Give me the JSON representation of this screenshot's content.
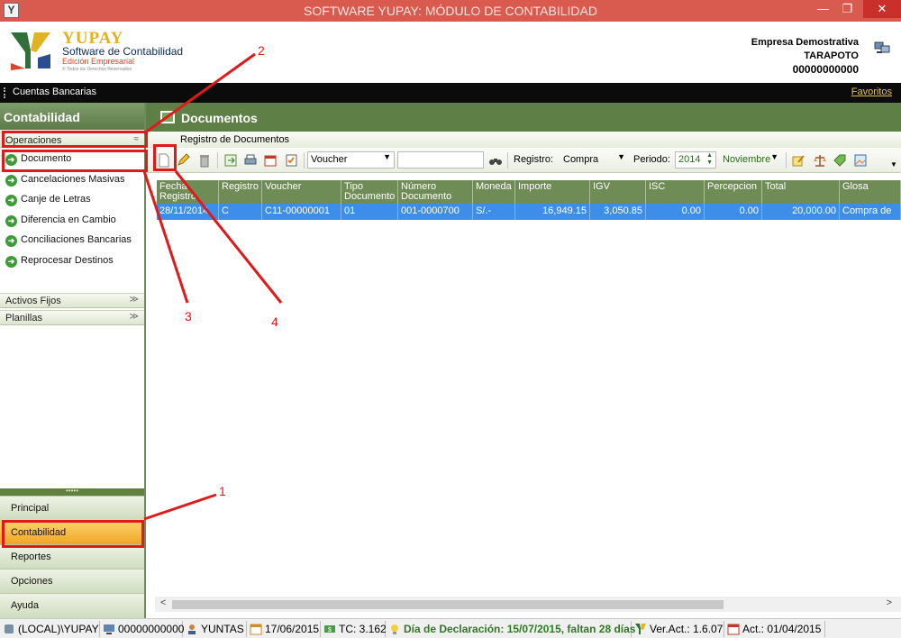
{
  "window": {
    "title": "SOFTWARE YUPAY: MÓDULO DE CONTABILIDAD",
    "app_icon": "Y",
    "minimize_icon": "—",
    "restore_icon": "❐",
    "close_icon": "✕"
  },
  "header": {
    "brand": "YUPAY",
    "tagline": "Software de Contabilidad",
    "edition": "Edición Empresarial",
    "rights": "© Todos los Derechos Reservados",
    "company": "Empresa Demostrativa",
    "city": "TARAPOTO",
    "ruc": "00000000000"
  },
  "menubar": {
    "current": "Cuentas Bancarias",
    "favorites": "Favoritos"
  },
  "sidebar": {
    "title": "Contabilidad",
    "sections": {
      "operaciones": {
        "label": "Operaciones",
        "chevron": "≈"
      },
      "activos": {
        "label": "Activos Fijos",
        "chevron": "≫"
      },
      "planillas": {
        "label": "Planillas",
        "chevron": "≫"
      }
    },
    "items": [
      {
        "label": "Documento"
      },
      {
        "label": "Cancelaciones Masivas"
      },
      {
        "label": "Canje de Letras"
      },
      {
        "label": "Diferencia en Cambio"
      },
      {
        "label": "Conciliaciones Bancarias"
      },
      {
        "label": "Reprocesar Destinos"
      }
    ],
    "splitter": "•••••",
    "nav": [
      {
        "label": "Principal"
      },
      {
        "label": "Contabilidad"
      },
      {
        "label": "Reportes"
      },
      {
        "label": "Opciones"
      },
      {
        "label": "Ayuda"
      }
    ]
  },
  "main": {
    "title": "Documentos",
    "subtitle": "Registro de Documentos",
    "toolbar": {
      "voucher_combo": "Voucher",
      "search_value": "",
      "registro_label": "Registro:",
      "registro_value": "Compra",
      "periodo_label": "Periodo:",
      "year": "2014",
      "month": "Noviembre"
    },
    "columns": [
      "Fecha Registro",
      "Registro",
      "Voucher",
      "Tipo Documento",
      "Número Documento",
      "Moneda",
      "Importe",
      "IGV",
      "ISC",
      "Percepcion",
      "Total",
      "Glosa"
    ],
    "rows": [
      [
        "28/11/2014",
        "C",
        "C11-00000001",
        "01",
        "001-0000700",
        "S/.-",
        "16,949.15",
        "3,050.85",
        "0.00",
        "0.00",
        "20,000.00",
        "Compra de"
      ]
    ]
  },
  "status": {
    "server": "(LOCAL)\\YUPAY",
    "ruc": "00000000000",
    "user": "YUNTAS",
    "date": "17/06/2015",
    "tc": "TC: 3.162",
    "declaration": "Día de Declaración: 15/07/2015, faltan 28 días",
    "version": "Ver.Act.: 1.6.07",
    "act": "Act.: 01/04/2015"
  },
  "annotations": [
    "1",
    "2",
    "3",
    "4"
  ],
  "colors": {
    "title_bar": "#d95a4e",
    "accent_green": "#5e7f45",
    "selected_row": "#3d8ee8",
    "highlight": "#e01a1a",
    "active_nav": "#f0a526"
  }
}
